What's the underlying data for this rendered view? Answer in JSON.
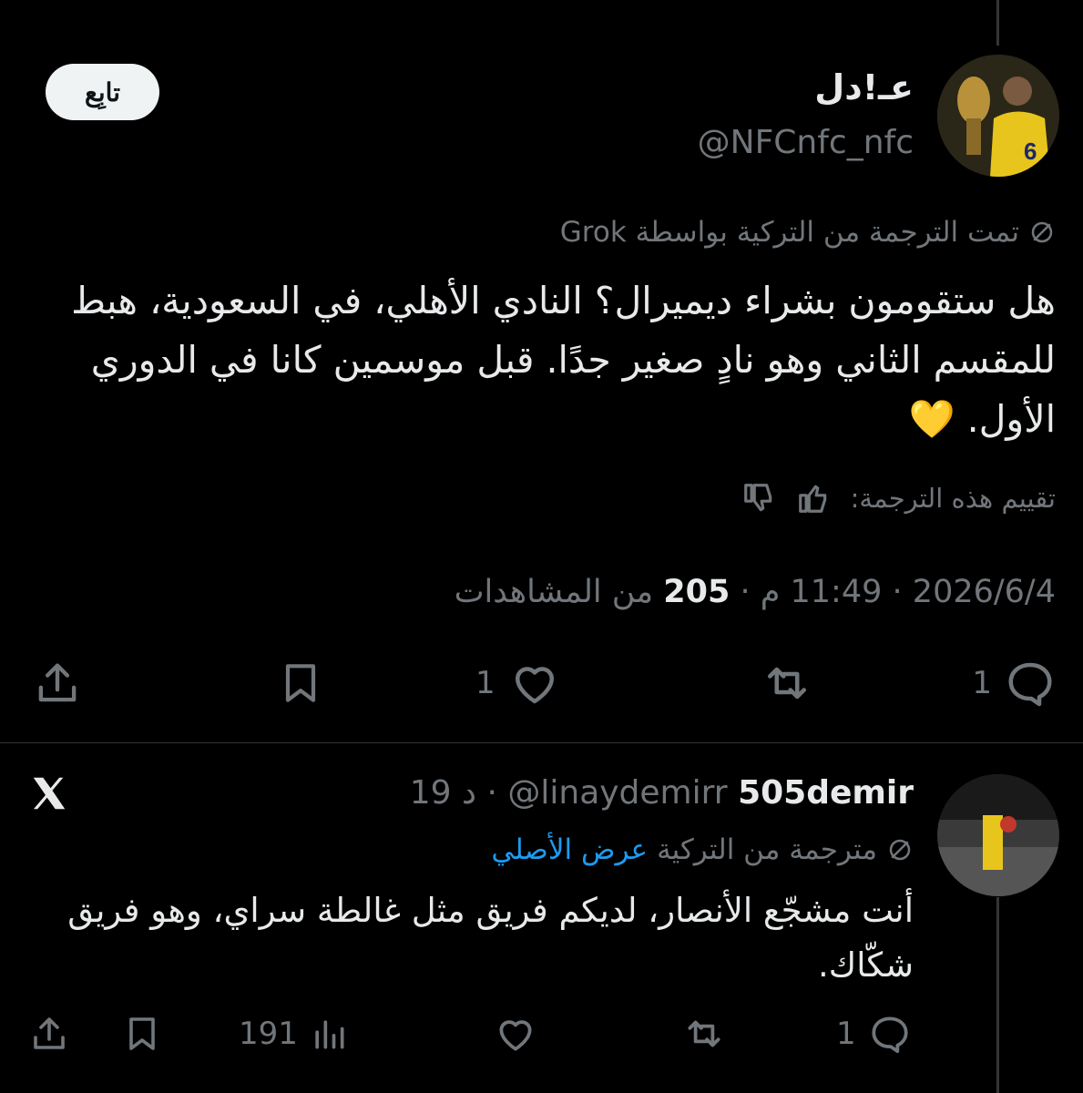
{
  "main_tweet": {
    "display_name": "عـ!دل",
    "handle": "@NFCnfc_nfc",
    "follow_label": "تابِع",
    "translation_note": "تمت الترجمة من التركية بواسطة Grok",
    "text": "هل ستقومون بشراء ديميرال؟ النادي الأهلي، في السعودية، هبط للمقسم الثاني وهو نادٍ صغير جدًا. قبل موسمين كانا في الدوري الأول. 💛",
    "rate_label": "تقييم هذه الترجمة:",
    "date": "2026/6/4",
    "time": "11:49 م",
    "views_count": "205",
    "views_label": "من المشاهدات",
    "replies": "1",
    "likes": "1"
  },
  "reply_tweet": {
    "display_name": "505demir",
    "handle": "@linaydemirr",
    "age": "19 د",
    "translation_note": "مترجمة من التركية",
    "show_original": "عرض الأصلي",
    "text": "أنت مشجّع الأنصار، لديكم فريق مثل غالطة سراي، وهو فريق شكّاك.",
    "replies": "1",
    "views": "191"
  },
  "colors": {
    "background": "#000000",
    "text": "#e7e9ea",
    "muted": "#71767b",
    "link": "#1d9bf0"
  }
}
